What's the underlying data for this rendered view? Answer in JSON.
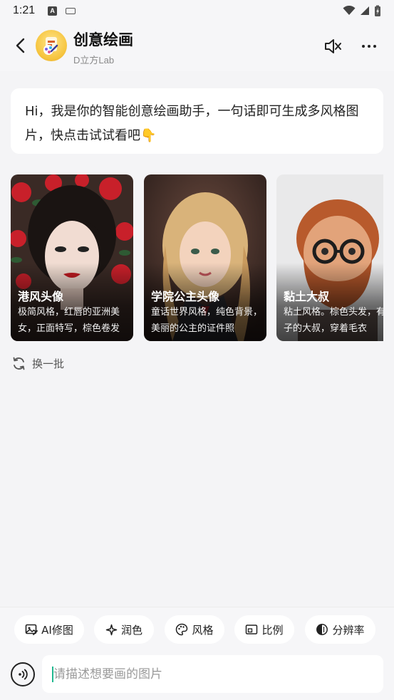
{
  "status_bar": {
    "time": "1:21",
    "left_icons": [
      "a-badge-icon",
      "keyboard-icon"
    ],
    "right_icons": [
      "wifi-icon",
      "signal-icon",
      "battery-charging-icon"
    ]
  },
  "header": {
    "title": "创意绘画",
    "subtitle": "D立方Lab",
    "back_icon": "chevron-left-icon",
    "mute_icon": "speaker-muted-icon",
    "more_icon": "more-dots-icon"
  },
  "greeting": {
    "text": "Hi，我是你的智能创意绘画助手，一句话即可生成多风格图片，快点击试试看吧👇"
  },
  "cards": [
    {
      "title": "港风头像",
      "desc": "极简风格，红唇的亚洲美女，正面特写，棕色卷发"
    },
    {
      "title": "学院公主头像",
      "desc": "童话世界风格，纯色背景，美丽的公主的证件照"
    },
    {
      "title": "黏土大叔",
      "desc": "粘土风格。棕色头发，有胡子的大叔，穿着毛衣"
    }
  ],
  "refresh": {
    "label": "换一批",
    "icon": "refresh-icon"
  },
  "chips": [
    {
      "label": "AI修图",
      "icon": "image-edit-icon"
    },
    {
      "label": "润色",
      "icon": "sparkle-icon"
    },
    {
      "label": "风格",
      "icon": "palette-icon"
    },
    {
      "label": "比例",
      "icon": "aspect-ratio-icon"
    },
    {
      "label": "分辨率",
      "icon": "resolution-icon"
    }
  ],
  "input": {
    "placeholder": "请描述想要画的图片",
    "value": "",
    "voice_icon": "voice-input-icon"
  },
  "colors": {
    "background": "#f4f4f6",
    "bubble": "#ffffff",
    "caret": "#1fb88f",
    "avatar": "#f6c540"
  }
}
